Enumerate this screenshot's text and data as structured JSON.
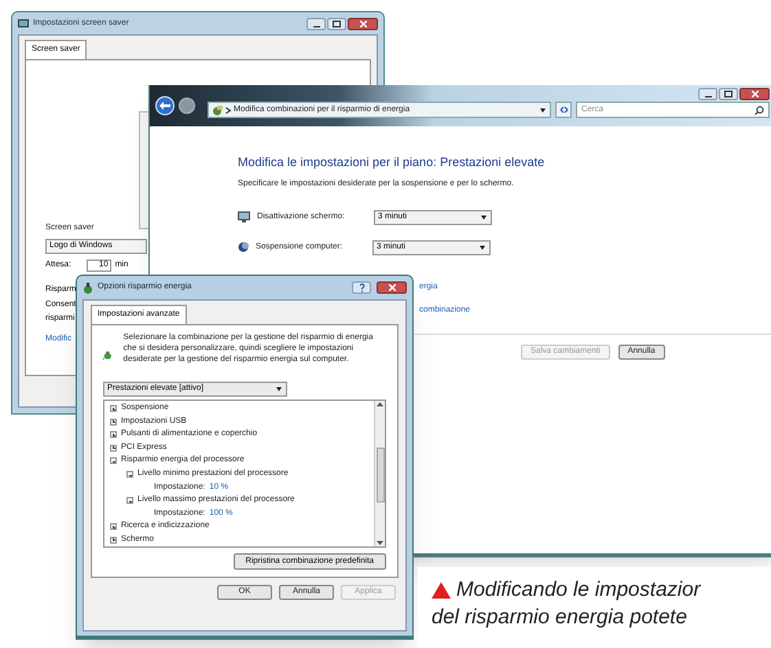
{
  "screen_saver_window": {
    "title": "Impostazioni screen saver",
    "tab": "Screen saver",
    "group_label": "Screen saver",
    "screen_saver": "Logo di Windows",
    "wait_label": "Attesa:",
    "wait_value": "10",
    "wait_unit": "min",
    "power_label": "Risparm",
    "power_text": [
      "Consent",
      "risparmi"
    ],
    "power_link": "Modific"
  },
  "power_plan_window": {
    "address": "Modifica combinazioni per il risparmio di energia",
    "search_placeholder": "Cerca",
    "heading": "Modifica le impostazioni per il piano: Prestazioni elevate",
    "subtitle": "Specificare le impostazioni desiderate per la sospensione e per lo schermo.",
    "settings": [
      {
        "kind": "display",
        "label": "Disattivazione schermo:",
        "value": "3 minuti"
      },
      {
        "kind": "sleep",
        "label": "Sospensione computer:",
        "value": "3 minuti"
      }
    ],
    "links": [
      "ergia",
      "combinazione"
    ],
    "buttons": [
      {
        "label": "Salva cambiamenti",
        "disabled": true
      },
      {
        "label": "Annulla",
        "disabled": false
      }
    ]
  },
  "power_options_dialog": {
    "title": "Opzioni risparmio energia",
    "tab": "Impostazioni avanzate",
    "description": "Selezionare la combinazione per la gestione del risparmio di energia che si desidera personalizzare, quindi scegliere le impostazioni desiderate per la gestione del risparmio energia sul computer.",
    "plan": "Prestazioni elevate [attivo]",
    "tree": [
      {
        "label": "Sospensione",
        "expanded": false
      },
      {
        "label": "Impostazioni USB",
        "expanded": false
      },
      {
        "label": "Pulsanti di alimentazione e coperchio",
        "expanded": false
      },
      {
        "label": "PCI Express",
        "expanded": false
      },
      {
        "label": "Risparmio energia del processore",
        "expanded": true,
        "children": [
          {
            "label": "Livello minimo prestazioni del processore",
            "expanded": true,
            "children": [
              {
                "label": "Impostazione:",
                "value": "10 %"
              }
            ]
          },
          {
            "label": "Livello massimo prestazioni del processore",
            "expanded": true,
            "children": [
              {
                "label": "Impostazione:",
                "value": "100 %"
              }
            ]
          }
        ]
      },
      {
        "label": "Ricerca e indicizzazione",
        "expanded": false
      },
      {
        "label": "Schermo",
        "expanded": false
      }
    ],
    "restore_button": "Ripristina combinazione predefinita",
    "buttons": [
      {
        "label": "OK",
        "disabled": false
      },
      {
        "label": "Annulla",
        "disabled": false
      },
      {
        "label": "Applica",
        "disabled": true
      }
    ]
  },
  "caption": [
    "Modificando le impostazior",
    "del risparmio energia potete"
  ]
}
